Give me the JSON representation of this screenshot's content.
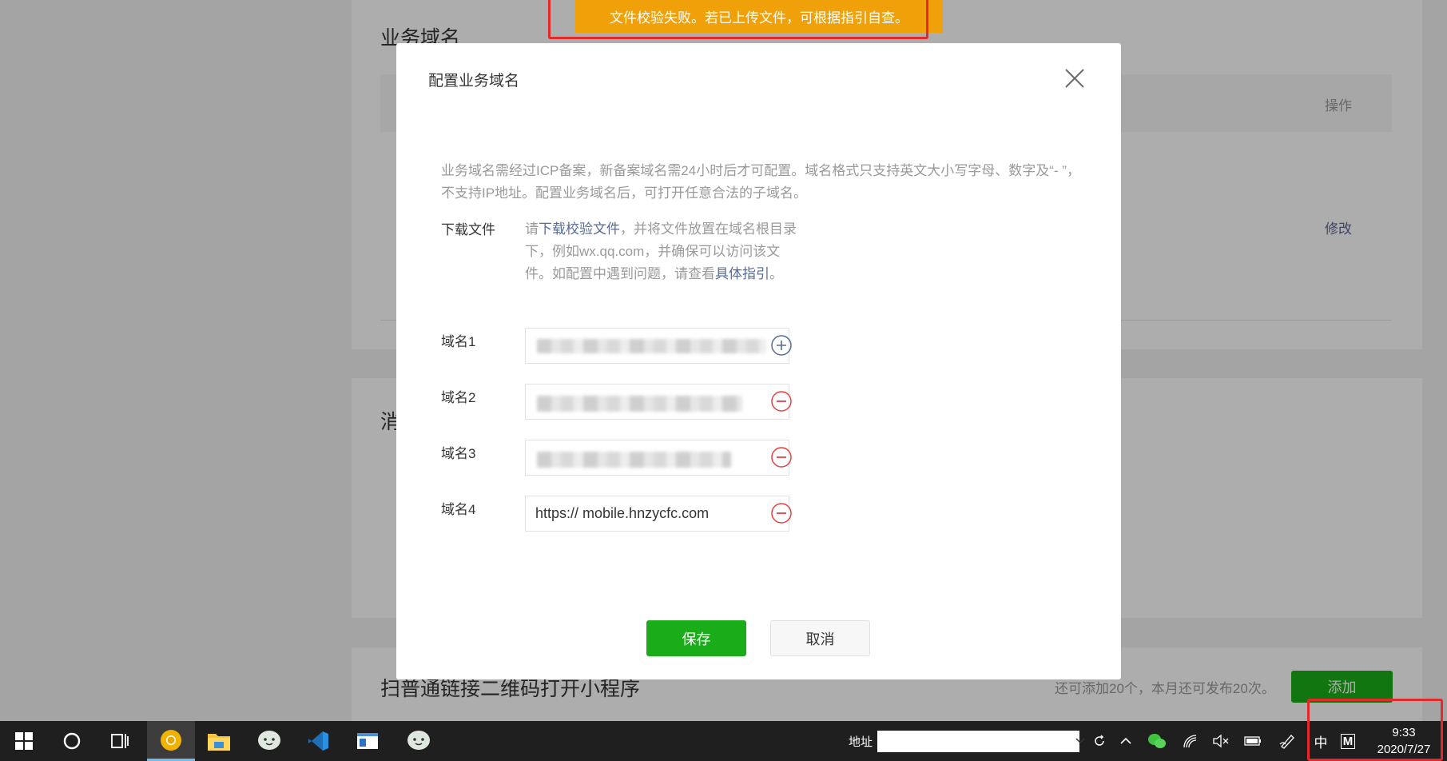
{
  "background": {
    "section1_title": "业务域名",
    "table_action_header": "操作",
    "edit_link": "修改",
    "section2_title_partial": "消",
    "section3_title": "扫普通链接二维码打开小程序",
    "quota_text": "还可添加20个，本月还可发布20次。",
    "add_button": "添加"
  },
  "toast": {
    "message": "文件校验失败。若已上传文件，可根据指引自查。"
  },
  "dialog": {
    "title": "配置业务域名",
    "description": "业务域名需经过ICP备案，新备案域名需24小时后才可配置。域名格式只支持英文大小写字母、数字及“- ”，不支持IP地址。配置业务域名后，可打开任意合法的子域名。",
    "download_label": "下载文件",
    "download_text_prefix": "请",
    "download_link": "下载校验文件",
    "download_text_middle": "，并将文件放置在域名根目录下，例如wx.qq.com，并确保可以访问该文件。如配置中遇到问题，请查看",
    "guide_link": "具体指引",
    "download_text_suffix": "。",
    "domains": [
      {
        "label": "域名1",
        "value": ""
      },
      {
        "label": "域名2",
        "value": ""
      },
      {
        "label": "域名3",
        "value": ""
      },
      {
        "label": "域名4",
        "value": "https:// mobile.hnzycfc.com"
      }
    ],
    "save_button": "保存",
    "cancel_button": "取消"
  },
  "taskbar": {
    "address_label": "地址",
    "ime_label": "中",
    "m_label": "M",
    "time": "9:33",
    "date": "2020/7/27"
  },
  "colors": {
    "toast": "#f0a109",
    "primary_green": "#1aad19",
    "link": "#576b95",
    "danger": "#e64340",
    "highlight_outline": "#e5282b"
  }
}
